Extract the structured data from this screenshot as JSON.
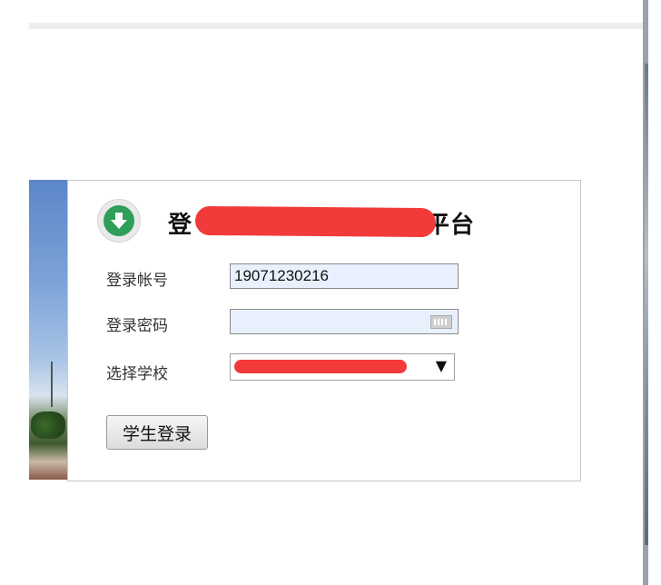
{
  "header": {
    "title_prefix": "登",
    "title_suffix": "平台"
  },
  "form": {
    "account_label": "登录帐号",
    "account_value": "19071230216",
    "password_label": "登录密码",
    "password_value": "",
    "school_label": "选择学校",
    "school_value": "",
    "submit_label": "学生登录"
  },
  "icons": {
    "logo": "download-arrow-icon",
    "keyboard": "keyboard-icon",
    "dropdown": "triangle-down-icon"
  },
  "colors": {
    "logo_green": "#2e9e58",
    "redaction": "#f23a3a",
    "input_fill": "#e8f0fe"
  }
}
